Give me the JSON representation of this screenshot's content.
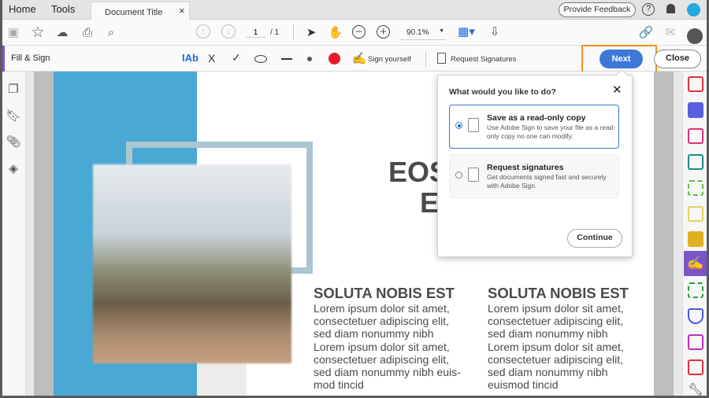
{
  "tabs": {
    "home": "Home",
    "tools": "Tools",
    "document": "Document Title",
    "close": "×"
  },
  "header": {
    "feedback": "Provide Feedback",
    "help": "?"
  },
  "toolbar": {
    "page_current": "1",
    "page_total": "/ 1",
    "zoom": "90.1%"
  },
  "fillsign": {
    "title": "Fill & Sign",
    "text_tool": "IAb",
    "cross": "X",
    "check": "✓",
    "sign_yourself": "Sign yourself",
    "request_signatures": "Request Signatures",
    "next": "Next",
    "close": "Close",
    "accent": "#e81b2d"
  },
  "popup": {
    "title": "What would you like to do?",
    "options": [
      {
        "title": "Save as a read-only copy",
        "desc": "Use Adobe Sign to save your file as a read-only copy no one can modify.",
        "selected": true
      },
      {
        "title": "Request signatures",
        "desc": "Get documents signed fast and securely with Adobe Sign.",
        "selected": false
      }
    ],
    "continue": "Continue"
  },
  "document": {
    "heading_line1": "EOS",
    "heading_line2": "ET",
    "columns": [
      {
        "heading": "SOLUTA NOBIS EST",
        "lines": [
          "Lorem ipsum dolor sit amet,",
          "consectetuer adipiscing elit,",
          "sed diam nonummy nibh",
          "Lorem ipsum dolor sit amet,",
          "consectetuer adipiscing elit,",
          "sed diam nonummy nibh euis-",
          "mod tincid"
        ]
      },
      {
        "heading": "SOLUTA NOBIS EST",
        "lines": [
          "Lorem ipsum dolor sit amet,",
          "consectetuer adipiscing elit,",
          "sed diam nonummy nibh",
          "Lorem ipsum dolor sit amet,",
          "consectetuer adipiscing elit,",
          "sed diam nonummy nibh",
          "euismod tincid"
        ]
      }
    ]
  },
  "colors": {
    "next_button": "#3b78d8",
    "highlight": "#f4901e",
    "fillsign_accent": "#7b55c7"
  }
}
